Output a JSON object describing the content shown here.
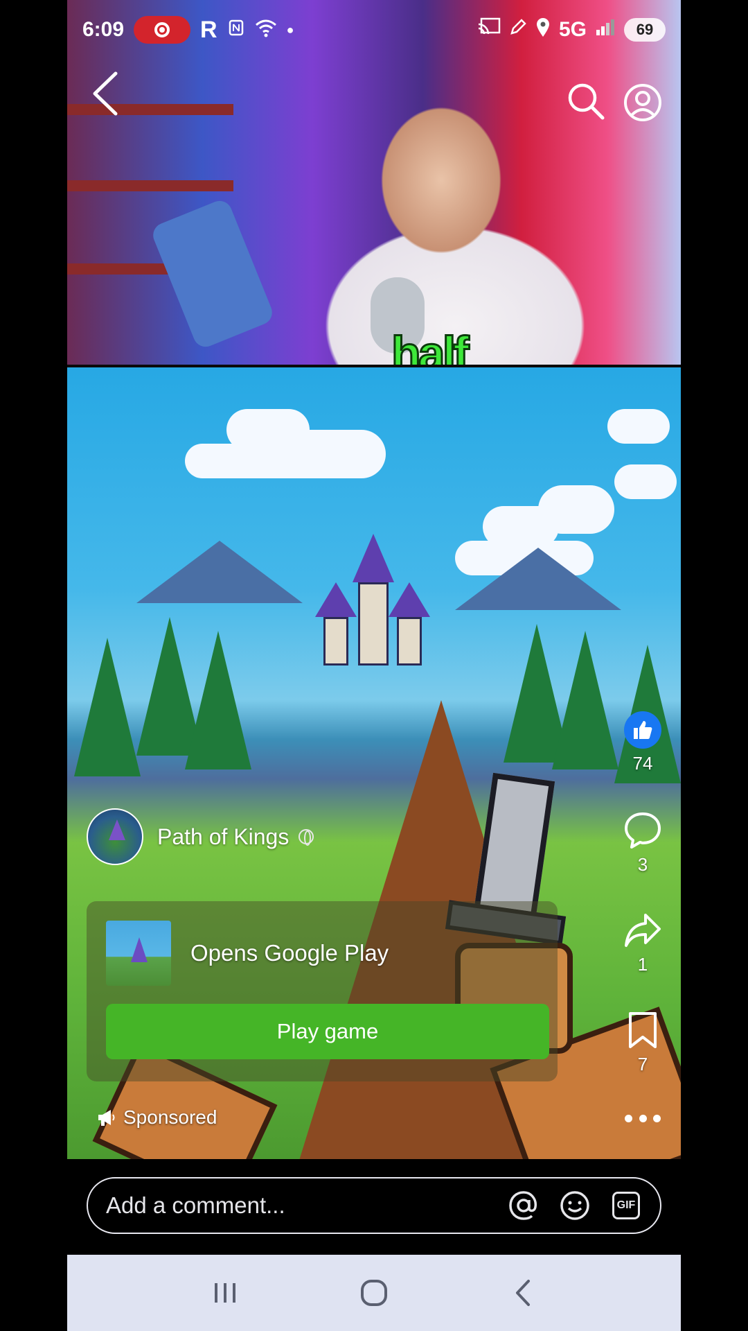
{
  "status_bar": {
    "time": "6:09",
    "app_letter": "R",
    "network": "5G",
    "battery": "69",
    "icons": [
      "screen-record-icon",
      "nfc-icon",
      "wifi-icon",
      "dot-icon",
      "cast-icon",
      "pen-icon",
      "location-icon",
      "signal-icon",
      "battery-icon"
    ]
  },
  "top_nav": {
    "icons": [
      "back-arrow-icon",
      "search-icon",
      "profile-icon"
    ]
  },
  "video": {
    "caption_word": "half"
  },
  "actions": {
    "like_count": "74",
    "comment_count": "3",
    "share_count": "1",
    "save_count": "7",
    "icons": [
      "thumbs-up-icon",
      "comment-bubble-icon",
      "share-arrow-icon",
      "bookmark-icon",
      "more-dots-icon"
    ]
  },
  "advertiser": {
    "name": "Path of Kings",
    "audience_icon": "globe-icon"
  },
  "cta": {
    "subtitle": "Opens Google Play",
    "button_label": "Play game"
  },
  "sponsored": {
    "label": "Sponsored",
    "icon": "megaphone-icon"
  },
  "comment": {
    "placeholder": "Add a comment...",
    "gif_label": "GIF",
    "icons": [
      "mention-icon",
      "emoji-icon",
      "gif-icon"
    ]
  },
  "system_nav": {
    "icons": [
      "recent-apps-icon",
      "home-icon",
      "back-icon"
    ]
  },
  "colors": {
    "like_blue": "#1877f2",
    "cta_green": "#45b527",
    "record_red": "#d3242c",
    "nav_bar": "#dfe3f2"
  }
}
